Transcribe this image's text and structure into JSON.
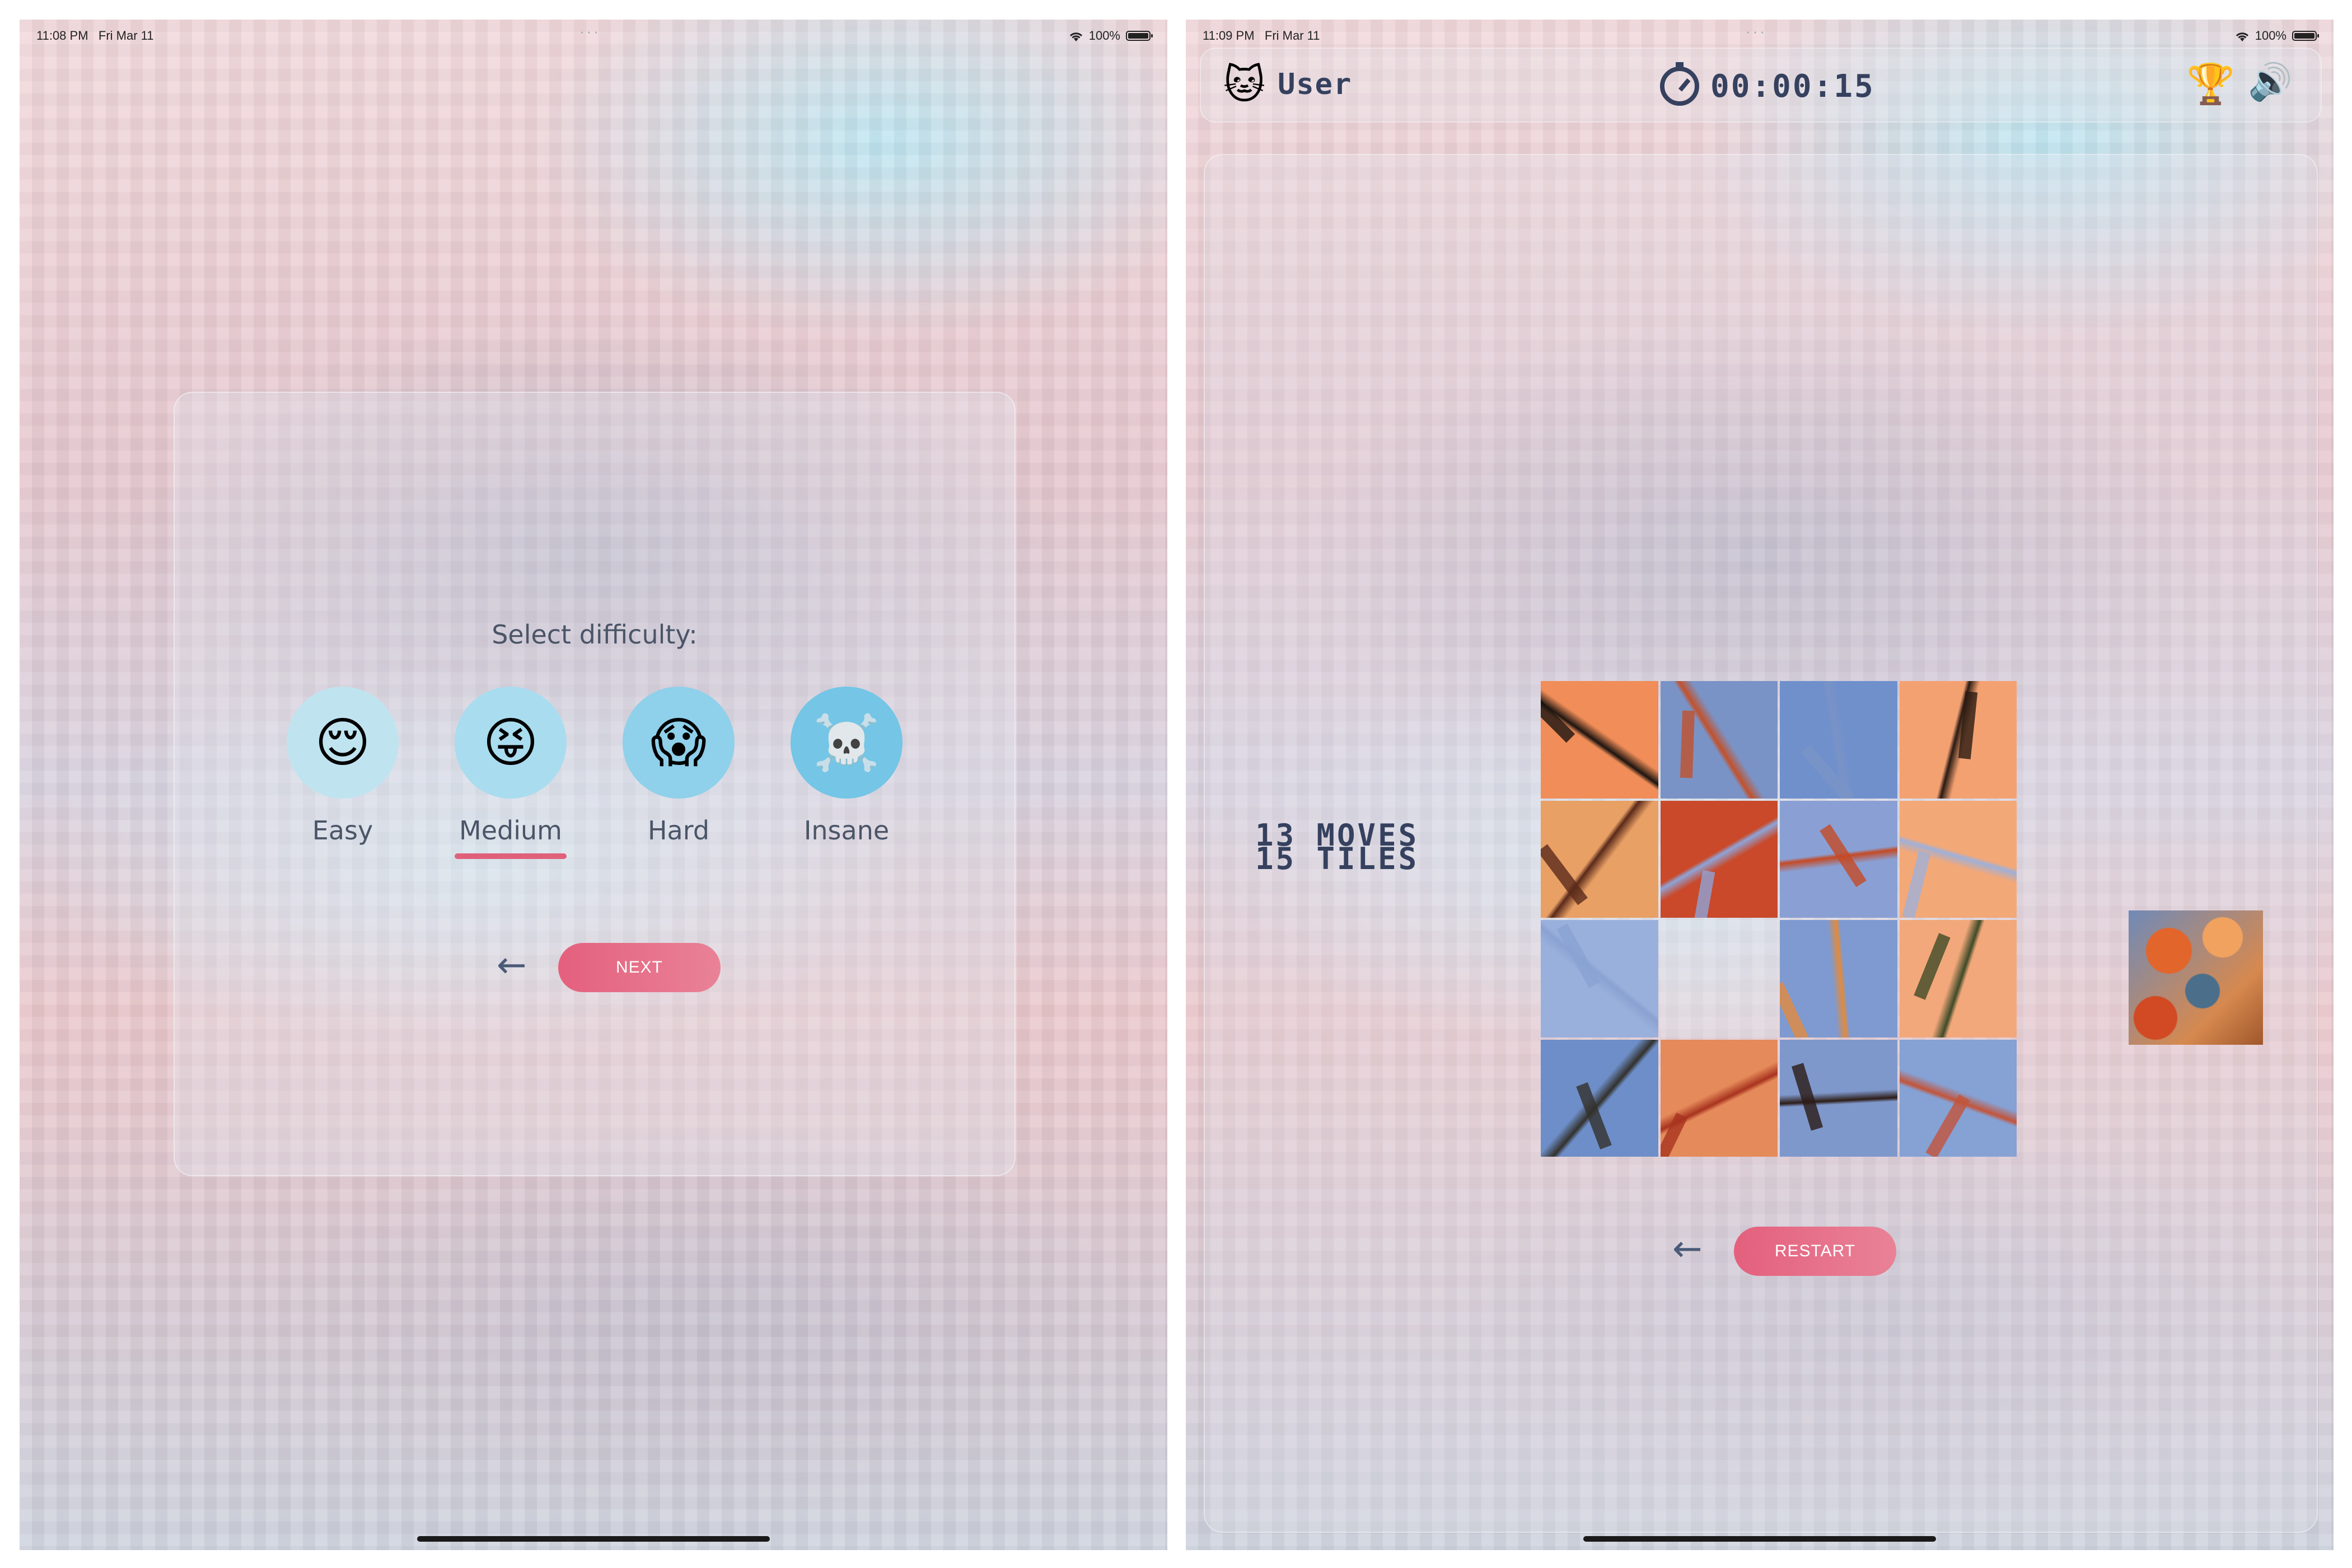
{
  "left_screen": {
    "status": {
      "time": "11:08 PM",
      "date": "Fri Mar 11",
      "battery": "100%"
    },
    "select_title": "Select difficulty:",
    "difficulties": [
      {
        "label": "Easy",
        "emoji": "😌",
        "circle_color": "#bfe4f0",
        "selected": false
      },
      {
        "label": "Medium",
        "emoji": "😝",
        "circle_color": "#a9dcef",
        "selected": true
      },
      {
        "label": "Hard",
        "emoji": "😱",
        "circle_color": "#8fd0ea",
        "selected": false
      },
      {
        "label": "Insane",
        "emoji": "☠️",
        "circle_color": "#74c5e6",
        "selected": false
      }
    ],
    "next_label": "NEXT"
  },
  "right_screen": {
    "status": {
      "time": "11:09 PM",
      "date": "Fri Mar 11",
      "battery": "100%"
    },
    "user_name": "User",
    "timer": "00:00:15",
    "moves_text": "13 MOVES",
    "tiles_text": "15 TILES",
    "restart_label": "RESTART",
    "tiles": [
      {
        "c1": "#f08d58",
        "c2": "#1c1410",
        "empty": false
      },
      {
        "c1": "#7a93c6",
        "c2": "#c2512b",
        "empty": false
      },
      {
        "c1": "#7090cc",
        "c2": "#7a93c6",
        "empty": false
      },
      {
        "c1": "#f4a171",
        "c2": "#2a1a12",
        "empty": false
      },
      {
        "c1": "#e9a065",
        "c2": "#5a2a1a",
        "empty": false
      },
      {
        "c1": "#c9492a",
        "c2": "#8ea4d8",
        "empty": false
      },
      {
        "c1": "#8aa0d4",
        "c2": "#c44a25",
        "empty": false
      },
      {
        "c1": "#f3a878",
        "c2": "#9fb0d8",
        "empty": false
      },
      {
        "c1": "#9ab0dc",
        "c2": "#8aa2d2",
        "empty": false
      },
      {
        "c1": "",
        "c2": "",
        "empty": true
      },
      {
        "c1": "#7e9ad0",
        "c2": "#e28a3c",
        "empty": false
      },
      {
        "c1": "#f2a87a",
        "c2": "#3f4a28",
        "empty": false
      },
      {
        "c1": "#6d8ec8",
        "c2": "#33312c",
        "empty": false
      },
      {
        "c1": "#e58a5a",
        "c2": "#a8331f",
        "empty": false
      },
      {
        "c1": "#7f98cc",
        "c2": "#2c1c16",
        "empty": false
      },
      {
        "c1": "#86a1d4",
        "c2": "#c3543a",
        "empty": false
      }
    ]
  }
}
